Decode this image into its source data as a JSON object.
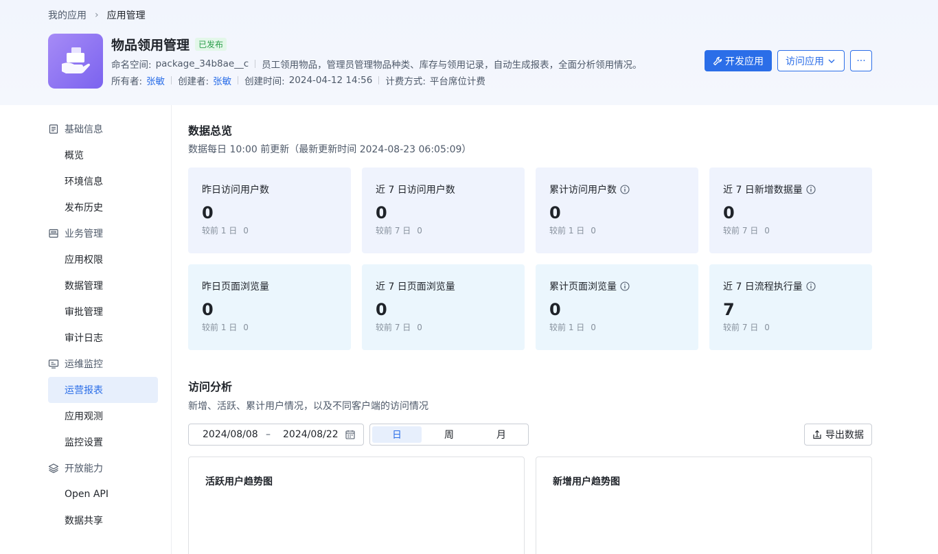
{
  "breadcrumb": {
    "parent": "我的应用",
    "separator": "›",
    "current": "应用管理"
  },
  "app": {
    "name": "物品领用管理",
    "status": "已发布",
    "namespace_label": "命名空间:",
    "namespace": "package_34b8ae__c",
    "description": "员工领用物品，管理员管理物品种类、库存与领用记录，自动生成报表，全面分析领用情况。",
    "owner_label": "所有者:",
    "owner": "张敏",
    "creator_label": "创建者:",
    "creator": "张敏",
    "created_label": "创建时间:",
    "created_time": "2024-04-12 14:56",
    "billing_label": "计费方式:",
    "billing": "平台席位计费"
  },
  "actions": {
    "develop": "开发应用",
    "visit": "访问应用",
    "more": "···"
  },
  "sidebar": {
    "groups": [
      {
        "label": "基础信息",
        "icon": "document-icon",
        "items": [
          "概览",
          "环境信息",
          "发布历史"
        ]
      },
      {
        "label": "业务管理",
        "icon": "briefcase-icon",
        "items": [
          "应用权限",
          "数据管理",
          "审批管理",
          "审计日志"
        ]
      },
      {
        "label": "运维监控",
        "icon": "monitor-icon",
        "items": [
          "运营报表",
          "应用观测",
          "监控设置"
        ]
      },
      {
        "label": "开放能力",
        "icon": "layers-icon",
        "items": [
          "Open API",
          "数据共享"
        ]
      }
    ],
    "active": "运营报表"
  },
  "overview": {
    "title": "数据总览",
    "subtitle": "数据每日 10:00 前更新（最新更新时间 2024-08-23 06:05:09）",
    "cards": [
      {
        "label": "昨日访问用户数",
        "value": "0",
        "compare_label": "较前 1 日",
        "compare_value": "0",
        "info": false
      },
      {
        "label": "近 7 日访问用户数",
        "value": "0",
        "compare_label": "较前 7 日",
        "compare_value": "0",
        "info": false
      },
      {
        "label": "累计访问用户数",
        "value": "0",
        "compare_label": "较前 1 日",
        "compare_value": "0",
        "info": true
      },
      {
        "label": "近 7 日新增数据量",
        "value": "0",
        "compare_label": "较前 7 日",
        "compare_value": "0",
        "info": true
      },
      {
        "label": "昨日页面浏览量",
        "value": "0",
        "compare_label": "较前 1 日",
        "compare_value": "0",
        "info": false
      },
      {
        "label": "近 7 日页面浏览量",
        "value": "0",
        "compare_label": "较前 7 日",
        "compare_value": "0",
        "info": false
      },
      {
        "label": "累计页面浏览量",
        "value": "0",
        "compare_label": "较前 1 日",
        "compare_value": "0",
        "info": true
      },
      {
        "label": "近 7 日流程执行量",
        "value": "7",
        "compare_label": "较前 7 日",
        "compare_value": "0",
        "info": true
      }
    ]
  },
  "analysis": {
    "title": "访问分析",
    "subtitle": "新增、活跃、累计用户情况，以及不同客户端的访问情况",
    "date_start": "2024/08/08",
    "date_sep": "–",
    "date_end": "2024/08/22",
    "granularity": [
      "日",
      "周",
      "月"
    ],
    "granularity_active": "日",
    "export": "导出数据",
    "charts": [
      "活跃用户趋势图",
      "新增用户趋势图"
    ]
  },
  "colors": {
    "primary": "#2b6ee8",
    "success": "#2a9d4a",
    "card_blue": "#eff3fd",
    "card_cyan": "#ebf6fd"
  }
}
